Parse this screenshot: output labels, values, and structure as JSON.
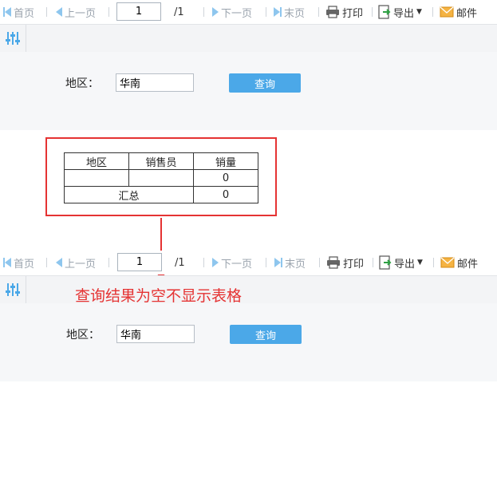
{
  "toolbar": {
    "first": "首页",
    "prev": "上一页",
    "page_value": "1",
    "total_pages": "/1",
    "next": "下一页",
    "last": "末页",
    "print": "打印",
    "export": "导出",
    "mail": "邮件"
  },
  "params": {
    "region_label": "地区：",
    "region_value": "华南",
    "query_button": "查询"
  },
  "report_table": {
    "headers": [
      "地区",
      "销售员",
      "销量"
    ],
    "rows": [
      [
        "",
        "",
        "0"
      ]
    ],
    "summary_label": "汇总",
    "summary_value": "0"
  },
  "annotation": "查询结果为空不显示表格",
  "colors": {
    "accent": "#4ba8e8",
    "annotation": "#e53333"
  }
}
